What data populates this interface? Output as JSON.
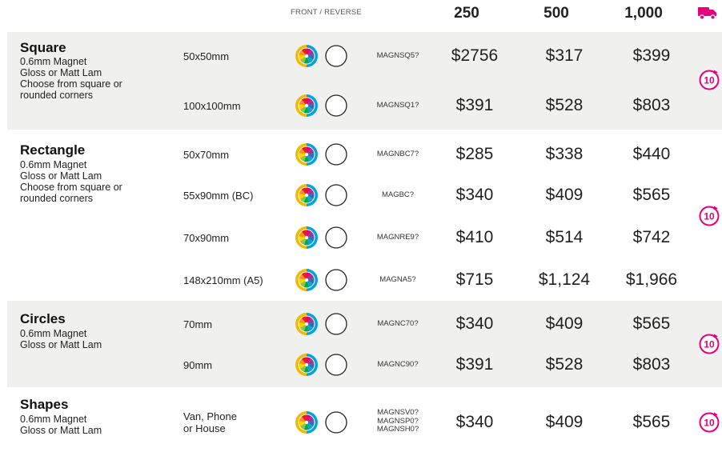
{
  "header": {
    "front_reverse": "FRONT / REVERSE",
    "qty": [
      "250",
      "500",
      "1,000"
    ],
    "truck_icon": "truck-icon"
  },
  "badge": {
    "label": "10",
    "icon": "turnaround-badge-icon",
    "color": "#e5007d"
  },
  "colors": {
    "band_gray": "#f0f0ef",
    "accent_magenta": "#e5007d"
  },
  "groups": [
    {
      "title": "Square",
      "desc": [
        "0.6mm Magnet",
        "Gloss or Matt Lam",
        "Choose from square or",
        "rounded corners"
      ],
      "rows": [
        {
          "size": "50x50mm",
          "code": "MAGNSQ5?",
          "prices": [
            "$2756",
            "$317",
            "$399"
          ]
        },
        {
          "size": "100x100mm",
          "code": "MAGNSQ1?",
          "prices": [
            "$391",
            "$528",
            "$803"
          ]
        }
      ]
    },
    {
      "title": "Rectangle",
      "desc": [
        "0.6mm Magnet",
        "Gloss or Matt Lam",
        "Choose from square or",
        "rounded corners"
      ],
      "rows": [
        {
          "size": "50x70mm",
          "code": "MAGNBC7?",
          "prices": [
            "$285",
            "$338",
            "$440"
          ]
        },
        {
          "size": "55x90mm (BC)",
          "code": "MAGBC?",
          "prices": [
            "$340",
            "$409",
            "$565"
          ]
        },
        {
          "size": "70x90mm",
          "code": "MAGNRE9?",
          "prices": [
            "$410",
            "$514",
            "$742"
          ]
        },
        {
          "size": "148x210mm (A5)",
          "code": "MAGNA5?",
          "prices": [
            "$715",
            "$1,124",
            "$1,966"
          ]
        }
      ]
    },
    {
      "title": "Circles",
      "desc": [
        "0.6mm Magnet",
        "Gloss or Matt Lam"
      ],
      "rows": [
        {
          "size": "70mm",
          "code": "MAGNC70?",
          "prices": [
            "$340",
            "$409",
            "$565"
          ]
        },
        {
          "size": "90mm",
          "code": "MAGNC90?",
          "prices": [
            "$391",
            "$528",
            "$803"
          ]
        }
      ]
    },
    {
      "title": "Shapes",
      "desc": [
        "0.6mm Magnet",
        "Gloss or Matt Lam"
      ],
      "rows": [
        {
          "size_lines": [
            "Van, Phone",
            "or House"
          ],
          "code_lines": [
            "MAGNSV0?",
            "MAGNSP0?",
            "MAGNSH0?"
          ],
          "prices": [
            "$340",
            "$409",
            "$565"
          ]
        }
      ]
    }
  ]
}
